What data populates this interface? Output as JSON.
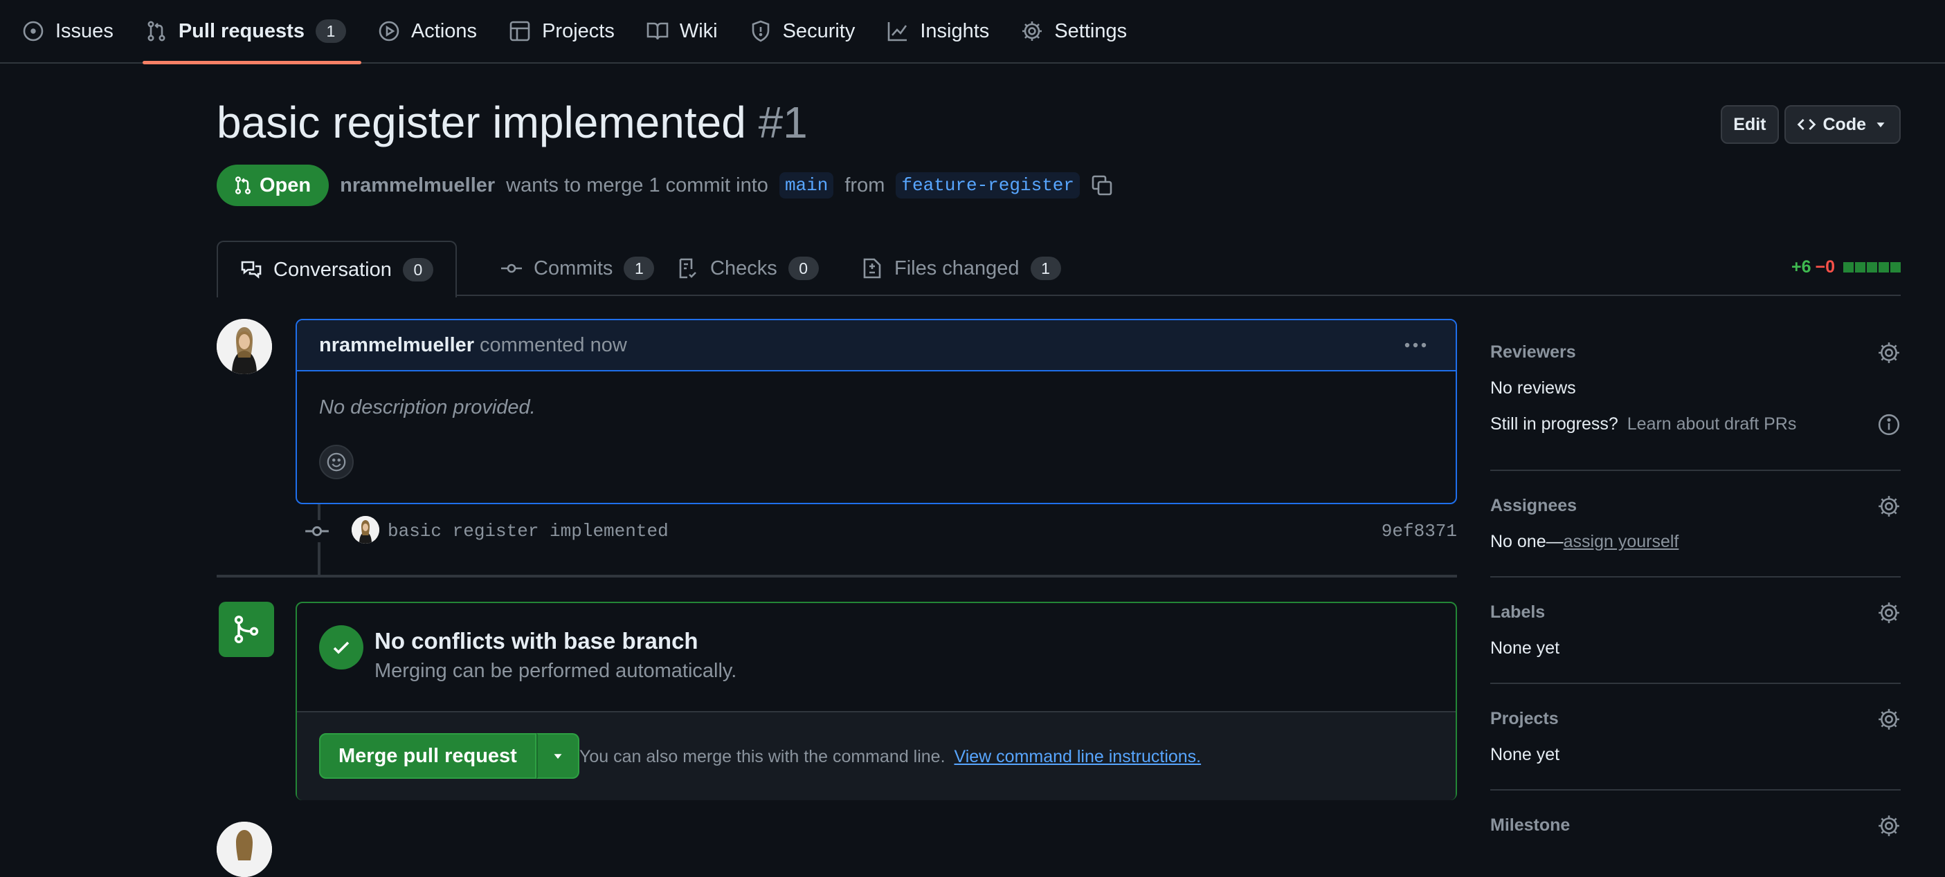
{
  "nav": {
    "items": [
      {
        "label": "Issues",
        "icon": "issue-opened-icon"
      },
      {
        "label": "Pull requests",
        "icon": "git-pull-request-icon",
        "count": "1",
        "active": true
      },
      {
        "label": "Actions",
        "icon": "play-icon"
      },
      {
        "label": "Projects",
        "icon": "table-icon"
      },
      {
        "label": "Wiki",
        "icon": "book-icon"
      },
      {
        "label": "Security",
        "icon": "shield-icon"
      },
      {
        "label": "Insights",
        "icon": "graph-icon"
      },
      {
        "label": "Settings",
        "icon": "gear-icon"
      }
    ]
  },
  "pr": {
    "title": "basic register implemented",
    "number": "#1",
    "state": "Open",
    "author": "nrammelmueller",
    "merge_text": "wants to merge 1 commit into",
    "base_branch": "main",
    "from_text": "from",
    "head_branch": "feature-register"
  },
  "header_buttons": {
    "edit": "Edit",
    "code": "Code"
  },
  "tabs": [
    {
      "label": "Conversation",
      "count": "0",
      "icon": "comment-discussion-icon"
    },
    {
      "label": "Commits",
      "count": "1",
      "icon": "git-commit-icon"
    },
    {
      "label": "Checks",
      "count": "0",
      "icon": "checklist-icon"
    },
    {
      "label": "Files changed",
      "count": "1",
      "icon": "file-diff-icon"
    }
  ],
  "diffstat": {
    "additions": "+6",
    "deletions": "−0"
  },
  "comment": {
    "author": "nrammelmueller",
    "time": "commented now",
    "body": "No description provided."
  },
  "commit": {
    "message": "basic register implemented",
    "sha": "9ef8371"
  },
  "merge": {
    "title": "No conflicts with base branch",
    "subtitle": "Merging can be performed automatically.",
    "button": "Merge pull request",
    "hint": "You can also merge this with the command line.",
    "hint_link": "View command line instructions."
  },
  "sidebar": {
    "reviewers": {
      "title": "Reviewers",
      "value": "No reviews",
      "draft_q": "Still in progress?",
      "draft_link": "Learn about draft PRs"
    },
    "assignees": {
      "title": "Assignees",
      "value": "No one—",
      "link": "assign yourself"
    },
    "labels": {
      "title": "Labels",
      "value": "None yet"
    },
    "projects": {
      "title": "Projects",
      "value": "None yet"
    },
    "milestone": {
      "title": "Milestone"
    }
  },
  "colors": {
    "accent_open": "#238636",
    "link": "#58a6ff",
    "tab_underline": "#f78166",
    "comment_border": "#1f6feb"
  }
}
